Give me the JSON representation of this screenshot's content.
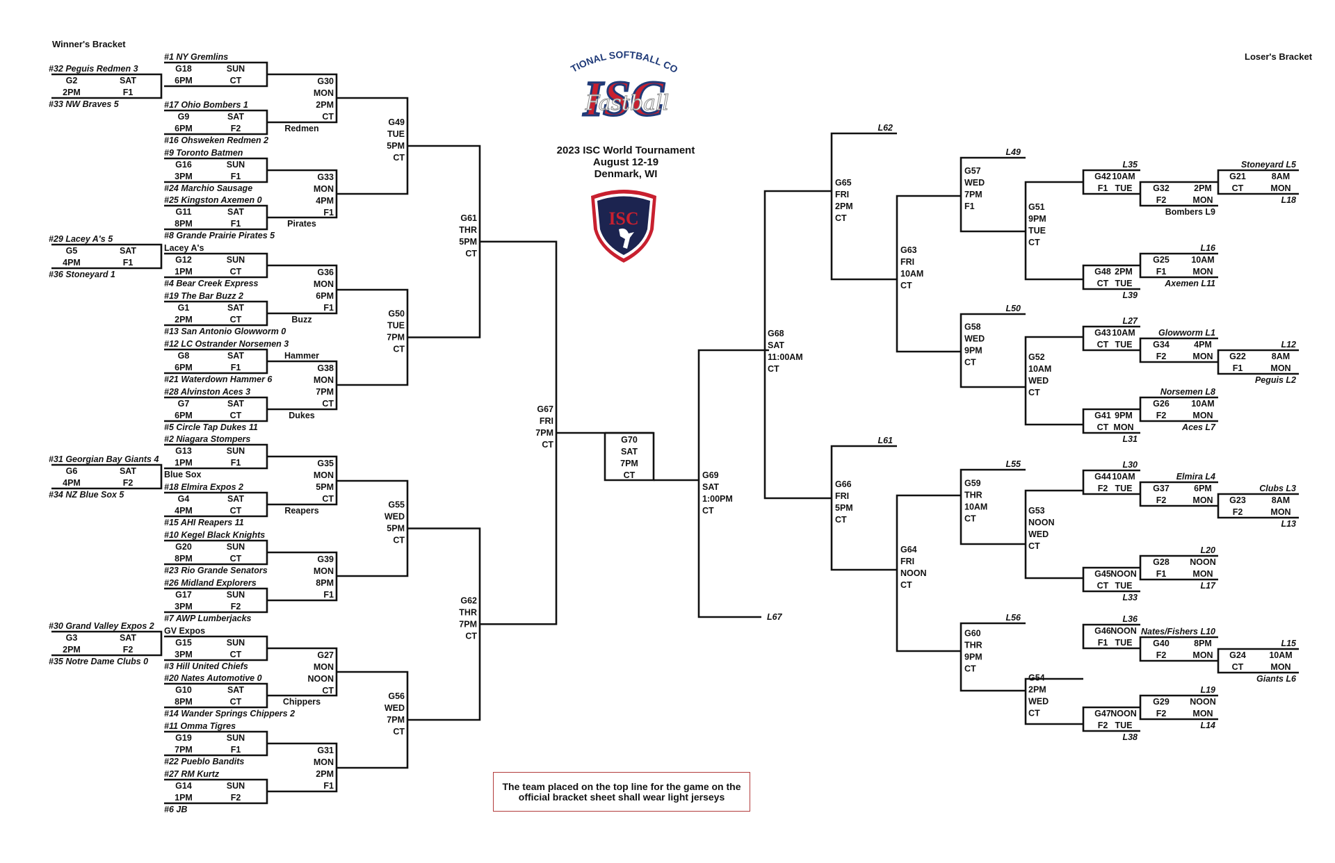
{
  "header": {
    "winners_label": "Winner's Bracket",
    "losers_label": "Loser's Bracket",
    "title_line1": "2023 ISC World Tournament",
    "title_line2": "August 12-19",
    "title_line3": "Denmark, WI",
    "logo_top_text": "INTERNATIONAL SOFTBALL CONGRESS",
    "logo_main_text": "ISC",
    "logo_script_text": "Fastball",
    "shield_text": "ISC"
  },
  "note": "The team placed on the top line for the game on the official bracket sheet shall wear light jerseys",
  "colors": {
    "logo_red": "#c8202f",
    "logo_blue": "#1f3a78",
    "note_border": "#b23a3a"
  },
  "winners": {
    "r1": [
      {
        "top": "#32 Peguis Redmen 3",
        "game": "G2",
        "day": "SAT",
        "time": "2PM",
        "field": "F1",
        "bottom": "#33 NW Braves 5"
      },
      {
        "top": "#29 Lacey A's 5",
        "game": "G5",
        "day": "SAT",
        "time": "4PM",
        "field": "F1",
        "bottom": "#36 Stoneyard 1"
      },
      {
        "top": "#31 Georgian Bay Giants 4",
        "game": "G6",
        "day": "SAT",
        "time": "4PM",
        "field": "F2",
        "bottom": "#34 NZ Blue Sox 5"
      },
      {
        "top": "#30 Grand Valley Expos 2",
        "game": "G3",
        "day": "SAT",
        "time": "2PM",
        "field": "F2",
        "bottom": "#35 Notre Dame Clubs 0"
      }
    ],
    "r2": [
      {
        "top": "#1 NY Gremlins",
        "game": "G18",
        "day": "SUN",
        "time": "6PM",
        "field": "CT",
        "bottom": ""
      },
      {
        "top": "#17 Ohio Bombers 1",
        "game": "G9",
        "day": "SAT",
        "time": "6PM",
        "field": "F2",
        "bottom": "#16 Ohsweken Redmen 2"
      },
      {
        "top": "#9 Toronto Batmen",
        "game": "G16",
        "day": "SUN",
        "time": "3PM",
        "field": "F1",
        "bottom": "#24 Marchio Sausage"
      },
      {
        "top": "#25 Kingston Axemen 0",
        "game": "G11",
        "day": "SAT",
        "time": "8PM",
        "field": "F1",
        "bottom": "#8 Grande Prairie Pirates 5"
      },
      {
        "top": "Lacey A's",
        "game": "G12",
        "day": "SUN",
        "time": "1PM",
        "field": "CT",
        "bottom": "#4 Bear Creek Express"
      },
      {
        "top": "#19 The Bar Buzz 2",
        "game": "G1",
        "day": "SAT",
        "time": "2PM",
        "field": "CT",
        "bottom": "#13 San Antonio Glowworm 0"
      },
      {
        "top": "#12 LC Ostrander Norsemen 3",
        "game": "G8",
        "day": "SAT",
        "time": "6PM",
        "field": "F1",
        "bottom": "#21 Waterdown Hammer 6"
      },
      {
        "top": "#28 Alvinston Aces 3",
        "game": "G7",
        "day": "SAT",
        "time": "6PM",
        "field": "CT",
        "bottom": "#5 Circle Tap Dukes 11"
      },
      {
        "top": "#2 Niagara Stompers",
        "game": "G13",
        "day": "SUN",
        "time": "1PM",
        "field": "F1",
        "bottom": "Blue Sox"
      },
      {
        "top": "#18 Elmira Expos 2",
        "game": "G4",
        "day": "SAT",
        "time": "4PM",
        "field": "CT",
        "bottom": "#15 AHI Reapers 11"
      },
      {
        "top": "#10 Kegel Black Knights",
        "game": "G20",
        "day": "SUN",
        "time": "8PM",
        "field": "CT",
        "bottom": "#23 Rio Grande Senators"
      },
      {
        "top": "#26 Midland Explorers",
        "game": "G17",
        "day": "SUN",
        "time": "3PM",
        "field": "F2",
        "bottom": "#7 AWP Lumberjacks"
      },
      {
        "top": "GV Expos",
        "game": "G15",
        "day": "SUN",
        "time": "3PM",
        "field": "CT",
        "bottom": "#3 Hill United Chiefs"
      },
      {
        "top": "#20 Nates Automotive 0",
        "game": "G10",
        "day": "SAT",
        "time": "8PM",
        "field": "CT",
        "bottom": "#14 Wander Springs Chippers 2"
      },
      {
        "top": "#11 Omma Tigres",
        "game": "G19",
        "day": "SUN",
        "time": "7PM",
        "field": "F1",
        "bottom": "#22 Pueblo Bandits"
      },
      {
        "top": "#27 RM Kurtz",
        "game": "G14",
        "day": "SUN",
        "time": "1PM",
        "field": "F2",
        "bottom": "#6  JB"
      }
    ],
    "r3": [
      {
        "game": "G30",
        "day": "MON",
        "time": "2PM",
        "field": "CT",
        "winner_below": "Redmen"
      },
      {
        "game": "G33",
        "day": "MON",
        "time": "4PM",
        "field": "F1",
        "winner_below": "Pirates"
      },
      {
        "game": "G36",
        "day": "MON",
        "time": "6PM",
        "field": "F1",
        "winner_below": "Buzz"
      },
      {
        "game": "G38",
        "day": "MON",
        "time": "7PM",
        "field": "CT",
        "winner_above": "Hammer",
        "winner_below": "Dukes"
      },
      {
        "game": "G35",
        "day": "MON",
        "time": "5PM",
        "field": "CT",
        "winner_below": "Reapers"
      },
      {
        "game": "G39",
        "day": "MON",
        "time": "8PM",
        "field": "F1"
      },
      {
        "game": "G27",
        "day": "MON",
        "time": "NOON",
        "field": "CT",
        "winner_below": "Chippers"
      },
      {
        "game": "G31",
        "day": "MON",
        "time": "2PM",
        "field": "F1"
      }
    ],
    "r4": [
      {
        "game": "G49",
        "day": "TUE",
        "time": "5PM",
        "field": "CT"
      },
      {
        "game": "G50",
        "day": "TUE",
        "time": "7PM",
        "field": "CT"
      },
      {
        "game": "G55",
        "day": "WED",
        "time": "5PM",
        "field": "CT"
      },
      {
        "game": "G56",
        "day": "WED",
        "time": "7PM",
        "field": "CT"
      }
    ],
    "r5": [
      {
        "game": "G61",
        "day": "THR",
        "time": "5PM",
        "field": "CT"
      },
      {
        "game": "G62",
        "day": "THR",
        "time": "7PM",
        "field": "CT"
      }
    ],
    "final": {
      "game": "G67",
      "day": "FRI",
      "time": "7PM",
      "field": "CT"
    },
    "championship": {
      "game": "G70",
      "day": "SAT",
      "time": "7PM",
      "field": "CT"
    },
    "championship2": {
      "game": "G69",
      "day": "SAT",
      "time": "1:00PM",
      "field": "CT"
    }
  },
  "losers": {
    "g68": {
      "game": "G68",
      "day": "SAT",
      "time": "11:00AM",
      "field": "CT"
    },
    "g65": {
      "game": "G65",
      "day": "FRI",
      "time": "2PM",
      "field": "CT",
      "feed": "L62"
    },
    "g66": {
      "game": "G66",
      "day": "FRI",
      "time": "5PM",
      "field": "CT",
      "feed": "L61"
    },
    "g63": {
      "game": "G63",
      "day": "FRI",
      "time": "10AM",
      "field": "CT"
    },
    "g64": {
      "game": "G64",
      "day": "FRI",
      "time": "NOON",
      "field": "CT"
    },
    "g57": {
      "game": "G57",
      "day": "WED",
      "time": "7PM",
      "field": "F1",
      "feed": "L49"
    },
    "g58": {
      "game": "G58",
      "day": "WED",
      "time": "9PM",
      "field": "CT",
      "feed": "L50"
    },
    "g59": {
      "game": "G59",
      "day": "THR",
      "time": "10AM",
      "field": "CT",
      "feed": "L55"
    },
    "g60": {
      "game": "G60",
      "day": "THR",
      "time": "9PM",
      "field": "CT",
      "feed": "L56"
    },
    "g51": {
      "game": "G51",
      "a": "9PM",
      "b": "TUE",
      "c": "CT"
    },
    "g52": {
      "game": "G52",
      "a": "10AM",
      "b": "WED",
      "c": "CT"
    },
    "g53": {
      "game": "G53",
      "a": "NOON",
      "b": "WED",
      "c": "CT"
    },
    "g54": {
      "game": "G54",
      "a": "2PM",
      "b": "WED",
      "c": "CT"
    },
    "l67": "L67",
    "r2": [
      {
        "game": "G42",
        "time": "10AM",
        "field": "F1",
        "day": "TUE",
        "top": "L35",
        "bottom": ""
      },
      {
        "game": "G48",
        "time": "2PM",
        "field": "CT",
        "day": "TUE",
        "top": "",
        "bottom": "L39"
      },
      {
        "game": "G43",
        "time": "10AM",
        "field": "CT",
        "day": "TUE",
        "top": "L27",
        "bottom": ""
      },
      {
        "game": "G41",
        "time": "9PM",
        "field": "CT",
        "day": "MON",
        "top": "",
        "bottom": "L31"
      },
      {
        "game": "G44",
        "time": "10AM",
        "field": "F2",
        "day": "TUE",
        "top": "L30",
        "bottom": ""
      },
      {
        "game": "G45",
        "time": "NOON",
        "field": "CT",
        "day": "TUE",
        "top": "",
        "bottom": "L33"
      },
      {
        "game": "G46",
        "time": "NOON",
        "field": "F1",
        "day": "TUE",
        "top": "L36",
        "bottom": ""
      },
      {
        "game": "G47",
        "time": "NOON",
        "field": "F2",
        "day": "TUE",
        "top": "",
        "bottom": "L38"
      }
    ],
    "r1": [
      {
        "game": "G32",
        "time": "2PM",
        "field": "F2",
        "day": "MON",
        "top": "",
        "bottom": "Bombers L9"
      },
      {
        "game": "G25",
        "time": "10AM",
        "field": "F1",
        "day": "MON",
        "top": "L16",
        "bottom": "Axemen L11"
      },
      {
        "game": "G34",
        "time": "4PM",
        "field": "F2",
        "day": "MON",
        "top": "Glowworm L1",
        "bottom": ""
      },
      {
        "game": "G26",
        "time": "10AM",
        "field": "F2",
        "day": "MON",
        "top": "Norsemen L8",
        "bottom": "Aces L7"
      },
      {
        "game": "G37",
        "time": "6PM",
        "field": "F2",
        "day": "MON",
        "top": "Elmira L4",
        "bottom": ""
      },
      {
        "game": "G28",
        "time": "NOON",
        "field": "F1",
        "day": "MON",
        "top": "L20",
        "bottom": "L17"
      },
      {
        "game": "G40",
        "time": "8PM",
        "field": "F2",
        "day": "MON",
        "top": "Nates/Fishers L10",
        "bottom": ""
      },
      {
        "game": "G29",
        "time": "NOON",
        "field": "F2",
        "day": "MON",
        "top": "L19",
        "bottom": "L14"
      }
    ],
    "r0": [
      {
        "game": "G21",
        "time": "8AM",
        "field": "CT",
        "day": "MON",
        "top": "Stoneyard L5",
        "bottom": "L18"
      },
      {
        "game": "G22",
        "time": "8AM",
        "field": "F1",
        "day": "MON",
        "top": "L12",
        "bottom": "Peguis L2"
      },
      {
        "game": "G23",
        "time": "8AM",
        "field": "F2",
        "day": "MON",
        "top": "Clubs L3",
        "bottom": "L13"
      },
      {
        "game": "G24",
        "time": "10AM",
        "field": "CT",
        "day": "MON",
        "top": "L15",
        "bottom": "Giants L6"
      }
    ]
  }
}
